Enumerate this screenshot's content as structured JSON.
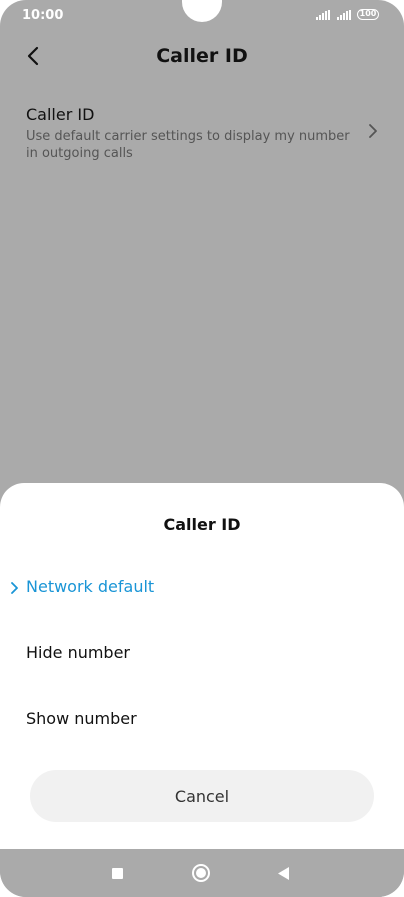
{
  "status_bar": {
    "time": "10:00",
    "battery": "100"
  },
  "header": {
    "title": "Caller ID"
  },
  "setting": {
    "title": "Caller ID",
    "subtitle": "Use default carrier settings to display my number in outgoing calls"
  },
  "dialog": {
    "title": "Caller ID",
    "options": [
      {
        "label": "Network default",
        "selected": true
      },
      {
        "label": "Hide number",
        "selected": false
      },
      {
        "label": "Show number",
        "selected": false
      }
    ],
    "cancel_label": "Cancel"
  },
  "colors": {
    "accent": "#1a95d6",
    "dim_overlay": "#aaaaaa",
    "sheet": "#ffffff"
  }
}
